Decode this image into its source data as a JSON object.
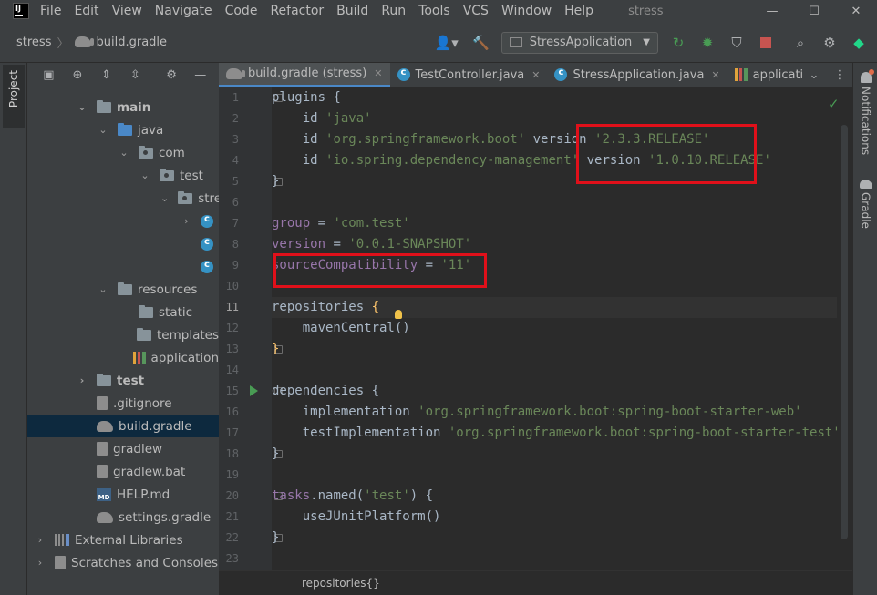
{
  "menubar": {
    "items": [
      "File",
      "Edit",
      "View",
      "Navigate",
      "Code",
      "Refactor",
      "Build",
      "Run",
      "Tools",
      "VCS",
      "Window",
      "Help"
    ],
    "window_title": "stress",
    "minimize": "—",
    "maximize": "☐",
    "close": "✕"
  },
  "navbar": {
    "project": "stress",
    "file": "build.gradle",
    "run_config": "StressApplication"
  },
  "left_strip": {
    "project_tab": "Project"
  },
  "project_tree": {
    "rows": [
      {
        "label": "main",
        "depth": 2,
        "chevron": "⌄",
        "icon": "folder",
        "bold": true
      },
      {
        "label": "java",
        "depth": 3,
        "chevron": "⌄",
        "icon": "folder-blue"
      },
      {
        "label": "com",
        "depth": 4,
        "chevron": "⌄",
        "icon": "folder-pkg"
      },
      {
        "label": "test",
        "depth": 5,
        "chevron": "⌄",
        "icon": "folder-pkg"
      },
      {
        "label": "stress",
        "depth": 6,
        "chevron": "⌄",
        "icon": "folder-pkg"
      },
      {
        "label": "",
        "depth": 7,
        "chevron": "›",
        "icon": "class"
      },
      {
        "label": "",
        "depth": 7,
        "chevron": "",
        "icon": "class"
      },
      {
        "label": "",
        "depth": 7,
        "chevron": "",
        "icon": "class"
      },
      {
        "label": "resources",
        "depth": 3,
        "chevron": "⌄",
        "icon": "folder"
      },
      {
        "label": "static",
        "depth": 4,
        "chevron": "",
        "icon": "folder"
      },
      {
        "label": "templates",
        "depth": 4,
        "chevron": "",
        "icon": "folder"
      },
      {
        "label": "application",
        "depth": 4,
        "chevron": "",
        "icon": "bars"
      },
      {
        "label": "test",
        "depth": 2,
        "chevron": "›",
        "icon": "folder",
        "bold": true
      },
      {
        "label": ".gitignore",
        "depth": 2,
        "chevron": "",
        "icon": "file"
      },
      {
        "label": "build.gradle",
        "depth": 2,
        "chevron": "",
        "icon": "elephant",
        "selected": true
      },
      {
        "label": "gradlew",
        "depth": 2,
        "chevron": "",
        "icon": "file"
      },
      {
        "label": "gradlew.bat",
        "depth": 2,
        "chevron": "",
        "icon": "file"
      },
      {
        "label": "HELP.md",
        "depth": 2,
        "chevron": "",
        "icon": "md"
      },
      {
        "label": "settings.gradle",
        "depth": 2,
        "chevron": "",
        "icon": "elephant"
      },
      {
        "label": "External Libraries",
        "depth": 0,
        "chevron": "›",
        "icon": "lib"
      },
      {
        "label": "Scratches and Consoles",
        "depth": 0,
        "chevron": "›",
        "icon": "scratch"
      }
    ]
  },
  "tabs": [
    {
      "label": "build.gradle (stress)",
      "icon": "elephant",
      "active": true,
      "close": "✕"
    },
    {
      "label": "TestController.java",
      "icon": "class",
      "close": "✕"
    },
    {
      "label": "StressApplication.java",
      "icon": "class",
      "close": "✕"
    },
    {
      "label": "applicati",
      "icon": "bars"
    }
  ],
  "editor": {
    "lines": [
      "1",
      "2",
      "3",
      "4",
      "5",
      "6",
      "7",
      "8",
      "9",
      "10",
      "11",
      "12",
      "13",
      "14",
      "15",
      "16",
      "17",
      "18",
      "19",
      "20",
      "21",
      "22",
      "23"
    ],
    "code": {
      "l1": "plugins {",
      "l2_kw": "id ",
      "l2_s": "'java'",
      "l3_kw": "id ",
      "l3_s": "'org.springframework.boot'",
      "l3_v": " version ",
      "l3_s2": "'2.3.3.RELEASE'",
      "l4_kw": "id ",
      "l4_s": "'io.spring.dependency-management'",
      "l4_v": " version ",
      "l4_s2": "'1.0.10.RELEASE'",
      "l5": "}",
      "l7_f": "group",
      "l7_eq": " = ",
      "l7_s": "'com.test'",
      "l8_f": "version",
      "l8_eq": " = ",
      "l8_s": "'0.0.1-SNAPSHOT'",
      "l9_f": "sourceCompatibility",
      "l9_eq": " = ",
      "l9_s": "'11'",
      "l11": "repositories ",
      "l11_b": "{",
      "l12": "mavenCentral()",
      "l13": "}",
      "l15": "dependencies {",
      "l16_kw": "implementation ",
      "l16_s": "'org.springframework.boot:spring-boot-starter-web'",
      "l17_kw": "testImplementation ",
      "l17_s": "'org.springframework.boot:spring-boot-starter-test'",
      "l18": "}",
      "l20_f": "tasks",
      "l20_a": ".named(",
      "l20_s": "'test'",
      "l20_b": ") {",
      "l21": "useJUnitPlatform()",
      "l22": "}"
    },
    "breadcrumb": "repositories{}"
  },
  "right_strip": {
    "notifications": "Notifications",
    "gradle": "Gradle"
  },
  "colors": {
    "highlight": "#e0101a",
    "accent": "#4a88c7",
    "string": "#6a8759",
    "field": "#9876aa"
  }
}
